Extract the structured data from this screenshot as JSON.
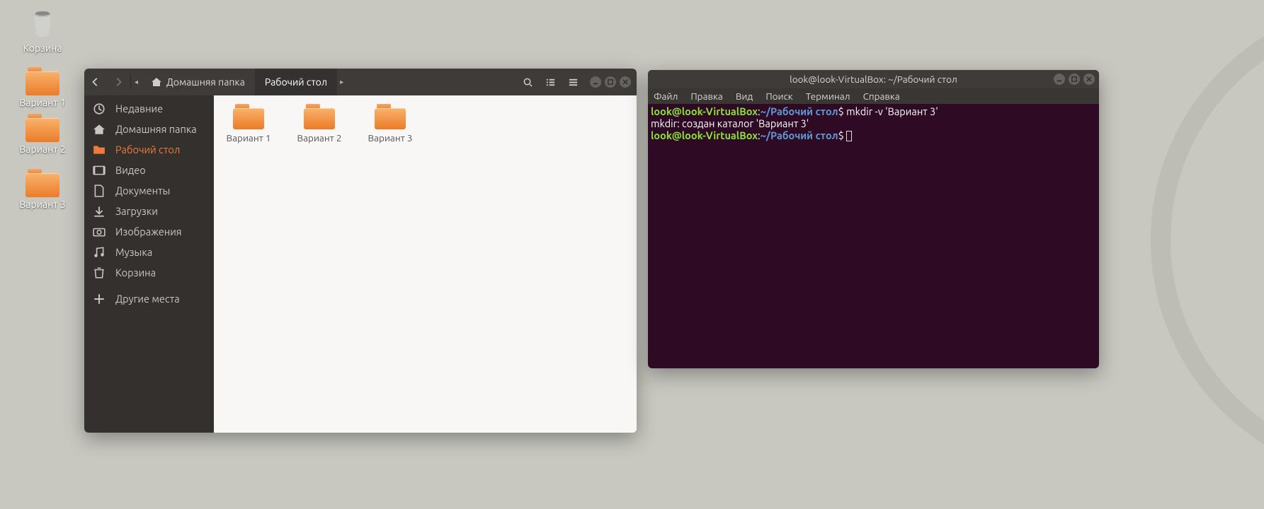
{
  "desktop": {
    "trash_label": "Корзина",
    "icons": [
      {
        "label": "Вариант 1"
      },
      {
        "label": "Вариант 2"
      },
      {
        "label": "Вариант 3"
      }
    ]
  },
  "fm": {
    "path_home_label": "Домашняя папка",
    "path_current_label": "Рабочий стол",
    "sidebar": [
      {
        "label": "Недавние"
      },
      {
        "label": "Домашняя папка"
      },
      {
        "label": "Рабочий стол"
      },
      {
        "label": "Видео"
      },
      {
        "label": "Документы"
      },
      {
        "label": "Загрузки"
      },
      {
        "label": "Изображения"
      },
      {
        "label": "Музыка"
      },
      {
        "label": "Корзина"
      },
      {
        "label": "Другие места"
      }
    ],
    "files": [
      {
        "label": "Вариант 1"
      },
      {
        "label": "Вариант 2"
      },
      {
        "label": "Вариант 3"
      }
    ]
  },
  "term": {
    "title": "look@look-VirtualBox: ~/Рабочий стол",
    "menu": [
      "Файл",
      "Правка",
      "Вид",
      "Поиск",
      "Терминал",
      "Справка"
    ],
    "prompt_user": "look@look-VirtualBox",
    "prompt_path": "~/Рабочий стол",
    "cmd1": "mkdir -v 'Вариант 3'",
    "out1": "mkdir: создан каталог 'Вариант 3'"
  }
}
